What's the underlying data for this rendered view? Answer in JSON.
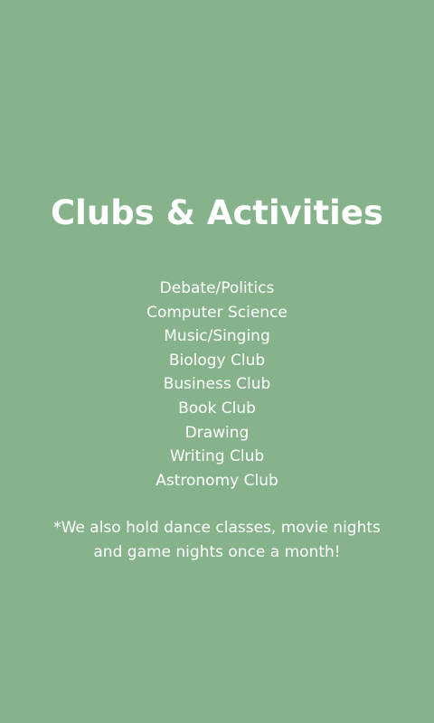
{
  "title": "Clubs & Activities",
  "clubs": [
    "Debate/Politics",
    "Computer Science",
    "Music/Singing",
    "Biology Club",
    "Business Club",
    "Book Club",
    "Drawing",
    "Writing Club",
    "Astronomy Club"
  ],
  "note": {
    "line1": "*We also hold dance classes, movie nights",
    "line2": "and game nights once a month!"
  },
  "colors": {
    "background": "#86b38b",
    "text": "#ffffff"
  }
}
